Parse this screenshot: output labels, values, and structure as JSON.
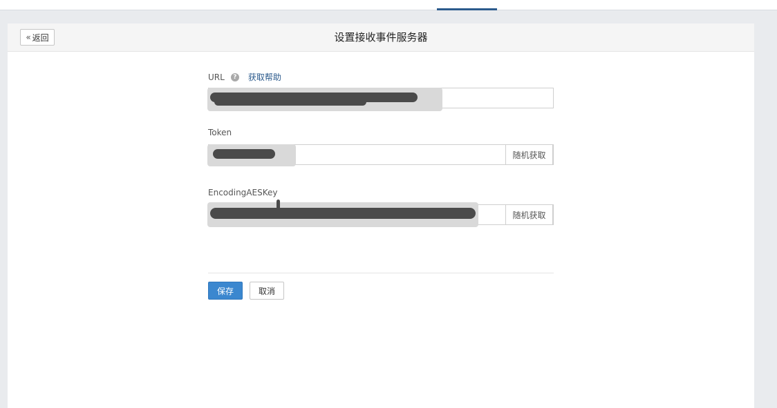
{
  "header": {
    "back_label": "返回",
    "title": "设置接收事件服务器"
  },
  "form": {
    "url": {
      "label": "URL",
      "help_link": "获取帮助",
      "value": ""
    },
    "token": {
      "label": "Token",
      "value": "",
      "random_label": "随机获取"
    },
    "aes": {
      "label": "EncodingAESKey",
      "value": "",
      "random_label": "随机获取"
    },
    "save_label": "保存",
    "cancel_label": "取消"
  },
  "colors": {
    "primary": "#3b87cf",
    "link": "#2b5a8c",
    "active_tab": "#2b5a8c"
  }
}
